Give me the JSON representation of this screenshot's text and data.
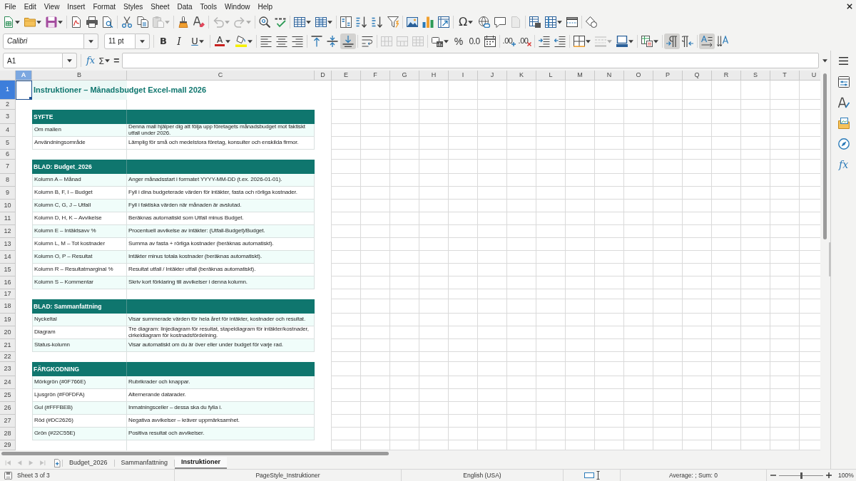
{
  "menu_bar": {
    "items": [
      "File",
      "Edit",
      "View",
      "Insert",
      "Format",
      "Styles",
      "Sheet",
      "Data",
      "Tools",
      "Window",
      "Help"
    ]
  },
  "standard_toolbar": {
    "groups": [
      [
        {
          "kind": "new",
          "dropdown": true,
          "disabled": false
        },
        {
          "kind": "open",
          "dropdown": true,
          "disabled": false
        },
        {
          "kind": "save",
          "dropdown": true,
          "disabled": false
        }
      ],
      [
        {
          "kind": "export_pdf",
          "dropdown": false,
          "disabled": false
        },
        {
          "kind": "print",
          "dropdown": false,
          "disabled": false
        },
        {
          "kind": "print_preview",
          "dropdown": false,
          "disabled": false
        }
      ],
      [
        {
          "kind": "cut",
          "dropdown": false,
          "disabled": false
        },
        {
          "kind": "copy",
          "dropdown": false,
          "disabled": false
        },
        {
          "kind": "paste",
          "dropdown": true,
          "disabled": true
        }
      ],
      [
        {
          "kind": "clone_formatting",
          "dropdown": false,
          "disabled": false
        },
        {
          "kind": "clear_formatting",
          "dropdown": false,
          "disabled": false
        }
      ],
      [
        {
          "kind": "undo",
          "dropdown": true,
          "disabled": true
        },
        {
          "kind": "redo",
          "dropdown": true,
          "disabled": true
        }
      ],
      [
        {
          "kind": "find_replace",
          "dropdown": false,
          "disabled": false
        },
        {
          "kind": "spelling",
          "dropdown": false,
          "disabled": false
        }
      ],
      [
        {
          "kind": "insert_rows",
          "dropdown": true,
          "disabled": false
        },
        {
          "kind": "insert_columns",
          "dropdown": true,
          "disabled": false
        }
      ],
      [
        {
          "kind": "sort",
          "dropdown": false,
          "disabled": false
        },
        {
          "kind": "sort_ascending",
          "dropdown": false,
          "disabled": false
        },
        {
          "kind": "sort_descending",
          "dropdown": false,
          "disabled": false
        },
        {
          "kind": "autofilter",
          "dropdown": false,
          "disabled": false
        }
      ],
      [
        {
          "kind": "image",
          "dropdown": false,
          "disabled": false
        },
        {
          "kind": "chart",
          "dropdown": false,
          "disabled": false
        },
        {
          "kind": "pivot_table",
          "dropdown": false,
          "disabled": false
        }
      ],
      [
        {
          "kind": "special_character",
          "label": "Ω",
          "dropdown": true,
          "disabled": false
        },
        {
          "kind": "hyperlink",
          "dropdown": false,
          "disabled": false
        },
        {
          "kind": "comment",
          "dropdown": false,
          "disabled": false
        },
        {
          "kind": "header_footer",
          "dropdown": false,
          "disabled": true
        }
      ],
      [
        {
          "kind": "print_area",
          "dropdown": false,
          "disabled": false
        },
        {
          "kind": "freeze",
          "dropdown": true,
          "disabled": false
        },
        {
          "kind": "split_window",
          "dropdown": false,
          "disabled": false
        }
      ],
      [
        {
          "kind": "draw_functions",
          "dropdown": false,
          "disabled": false
        }
      ]
    ]
  },
  "formatting_toolbar": {
    "font_name": "Calibri",
    "font_size": "11 pt",
    "groups": [
      [
        {
          "kind": "bold",
          "label": "B",
          "dropdown": false,
          "disabled": false,
          "on": false
        },
        {
          "kind": "italic",
          "label": "I",
          "dropdown": false,
          "disabled": false,
          "on": false
        },
        {
          "kind": "underline",
          "label": "U",
          "dropdown": true,
          "disabled": false,
          "on": false
        }
      ],
      [
        {
          "kind": "font_color",
          "label": "A",
          "dropdown": true,
          "disabled": false,
          "on": false
        },
        {
          "kind": "highlight",
          "dropdown": true,
          "disabled": false,
          "on": false
        }
      ],
      [
        {
          "kind": "align_left",
          "dropdown": false,
          "disabled": false,
          "on": false
        },
        {
          "kind": "align_center",
          "dropdown": false,
          "disabled": false,
          "on": false
        },
        {
          "kind": "align_right",
          "dropdown": false,
          "disabled": false,
          "on": false
        }
      ],
      [
        {
          "kind": "align_top",
          "dropdown": false,
          "disabled": false,
          "on": false
        },
        {
          "kind": "align_middle",
          "dropdown": false,
          "disabled": false,
          "on": false
        },
        {
          "kind": "align_bottom",
          "dropdown": false,
          "disabled": false,
          "on": true
        }
      ],
      [
        {
          "kind": "wrap_text",
          "dropdown": false,
          "disabled": false,
          "on": false
        }
      ],
      [
        {
          "kind": "merge_center",
          "dropdown": false,
          "disabled": true,
          "on": false
        },
        {
          "kind": "merge_cells",
          "dropdown": false,
          "disabled": true,
          "on": false
        },
        {
          "kind": "unmerge_cells",
          "dropdown": false,
          "disabled": true,
          "on": false
        }
      ],
      [
        {
          "kind": "currency",
          "dropdown": true,
          "disabled": false,
          "on": false
        },
        {
          "kind": "percent",
          "label": "%",
          "dropdown": false,
          "disabled": false,
          "on": false
        },
        {
          "kind": "number",
          "label": "0.0",
          "dropdown": false,
          "disabled": false,
          "on": false
        },
        {
          "kind": "date",
          "dropdown": false,
          "disabled": false,
          "on": false
        }
      ],
      [
        {
          "kind": "add_decimal",
          "label": ".00",
          "dropdown": false,
          "disabled": false,
          "on": false
        },
        {
          "kind": "delete_decimal",
          "label": ".00",
          "dropdown": false,
          "disabled": false,
          "on": false
        }
      ],
      [
        {
          "kind": "indent_increase",
          "dropdown": false,
          "disabled": false,
          "on": false
        },
        {
          "kind": "indent_decrease",
          "dropdown": false,
          "disabled": false,
          "on": false
        }
      ],
      [
        {
          "kind": "borders",
          "dropdown": true,
          "disabled": false,
          "on": false
        },
        {
          "kind": "border_style",
          "dropdown": true,
          "disabled": true,
          "on": false
        },
        {
          "kind": "border_color",
          "dropdown": true,
          "disabled": false,
          "on": false
        }
      ],
      [
        {
          "kind": "conditional",
          "dropdown": true,
          "disabled": false,
          "on": false
        }
      ],
      [
        {
          "kind": "para_ltr",
          "dropdown": false,
          "disabled": false,
          "on": true
        },
        {
          "kind": "para_rtl",
          "dropdown": false,
          "disabled": false,
          "on": false
        }
      ],
      [
        {
          "kind": "text_ltr",
          "dropdown": false,
          "disabled": false,
          "on": true
        },
        {
          "kind": "text_ttb",
          "dropdown": false,
          "disabled": false,
          "on": false
        }
      ]
    ]
  },
  "formula_bar": {
    "name_box": "A1",
    "function_wizard": "fx",
    "sum": "Σ",
    "equals": "="
  },
  "sidebar": {
    "decks": [
      {
        "kind": "properties",
        "selected": false
      },
      {
        "kind": "styles",
        "selected": false
      },
      {
        "kind": "gallery",
        "selected": false
      },
      {
        "kind": "navigator",
        "selected": false
      },
      {
        "kind": "functions",
        "label": "fx",
        "selected": false
      }
    ]
  },
  "sheet": {
    "columns": [
      {
        "label": "A",
        "selected": true
      },
      {
        "label": "B",
        "selected": false
      },
      {
        "label": "C",
        "selected": false
      },
      {
        "label": "D",
        "selected": false
      },
      {
        "label": "E",
        "selected": false
      },
      {
        "label": "F",
        "selected": false
      },
      {
        "label": "G",
        "selected": false
      },
      {
        "label": "H",
        "selected": false
      },
      {
        "label": "I",
        "selected": false
      },
      {
        "label": "J",
        "selected": false
      },
      {
        "label": "K",
        "selected": false
      },
      {
        "label": "L",
        "selected": false
      },
      {
        "label": "M",
        "selected": false
      },
      {
        "label": "N",
        "selected": false
      },
      {
        "label": "O",
        "selected": false
      },
      {
        "label": "P",
        "selected": false
      },
      {
        "label": "Q",
        "selected": false
      },
      {
        "label": "R",
        "selected": false
      },
      {
        "label": "S",
        "selected": false
      },
      {
        "label": "T",
        "selected": false
      },
      {
        "label": "U",
        "selected": false
      }
    ],
    "rows": [
      {
        "number": "1",
        "selected": true,
        "kind": "title",
        "cells": [
          "Instruktioner – Månadsbudget Excel-mall 2026"
        ]
      },
      {
        "number": "2",
        "selected": false,
        "kind": "blank"
      },
      {
        "number": "3",
        "selected": false,
        "kind": "header",
        "cells": [
          "SYFTE"
        ]
      },
      {
        "number": "4",
        "selected": false,
        "kind": "data",
        "cells": [
          "Om mallen",
          "Denna mall hjälper dig att följa upp företagets månadsbudget mot faktiskt utfall under 2026."
        ]
      },
      {
        "number": "5",
        "selected": false,
        "kind": "data",
        "cells": [
          "Användningsområde",
          "Lämplig för små och medelstora företag, konsulter och enskilda firmor."
        ]
      },
      {
        "number": "6",
        "selected": false,
        "kind": "blank"
      },
      {
        "number": "7",
        "selected": false,
        "kind": "header",
        "cells": [
          "BLAD: Budget_2026"
        ]
      },
      {
        "number": "8",
        "selected": false,
        "kind": "data",
        "cells": [
          "Kolumn A – Månad",
          "Anger månadsstart i formatet YYYY-MM-DD (t.ex. 2026-01-01)."
        ]
      },
      {
        "number": "9",
        "selected": false,
        "kind": "data",
        "cells": [
          "Kolumn B, F, I – Budget",
          "Fyll i dina budgeterade värden för intäkter, fasta och rörliga kostnader."
        ]
      },
      {
        "number": "10",
        "selected": false,
        "kind": "data",
        "cells": [
          "Kolumn C, G, J – Utfall",
          "Fyll i faktiska värden när månaden är avslutad."
        ]
      },
      {
        "number": "11",
        "selected": false,
        "kind": "data",
        "cells": [
          "Kolumn D, H, K – Avvikelse",
          "Beräknas automatiskt som Utfall minus Budget."
        ]
      },
      {
        "number": "12",
        "selected": false,
        "kind": "data",
        "cells": [
          "Kolumn E – Intäktsavv %",
          "Procentuell avvikelse av intäkter: (Utfall-Budget)/Budget."
        ]
      },
      {
        "number": "13",
        "selected": false,
        "kind": "data",
        "cells": [
          "Kolumn L, M – Tot kostnader",
          "Summa av fasta + rörliga kostnader (beräknas automatiskt)."
        ]
      },
      {
        "number": "14",
        "selected": false,
        "kind": "data",
        "cells": [
          "Kolumn O, P – Resultat",
          "Intäkter minus totala kostnader (beräknas automatiskt)."
        ]
      },
      {
        "number": "15",
        "selected": false,
        "kind": "data",
        "cells": [
          "Kolumn R – Resultatmarginal %",
          "Resultat utfall / Intäkter utfall (beräknas automatiskt)."
        ]
      },
      {
        "number": "16",
        "selected": false,
        "kind": "data",
        "cells": [
          "Kolumn S – Kommentar",
          "Skriv kort förklaring till avvikelser i denna kolumn."
        ]
      },
      {
        "number": "17",
        "selected": false,
        "kind": "blank"
      },
      {
        "number": "18",
        "selected": false,
        "kind": "header",
        "cells": [
          "BLAD: Sammanfattning"
        ]
      },
      {
        "number": "19",
        "selected": false,
        "kind": "data",
        "cells": [
          "Nyckeltal",
          "Visar summerade värden för hela året för intäkter, kostnader och resultat."
        ]
      },
      {
        "number": "20",
        "selected": false,
        "kind": "data",
        "cells": [
          "Diagram",
          "Tre diagram: linjediagram för resultat, stapeldiagram för intäkter/kostnader, cirkeldiagram för kostnadsfördelning."
        ]
      },
      {
        "number": "21",
        "selected": false,
        "kind": "data",
        "cells": [
          "Status-kolumn",
          "Visar automatiskt om du är över eller under budget för varje rad."
        ]
      },
      {
        "number": "22",
        "selected": false,
        "kind": "blank"
      },
      {
        "number": "23",
        "selected": false,
        "kind": "header",
        "cells": [
          "FÄRGKODNING"
        ]
      },
      {
        "number": "24",
        "selected": false,
        "kind": "data",
        "cells": [
          "Mörkgrön (#0F766E)",
          "Rubrikrader och knappar."
        ]
      },
      {
        "number": "25",
        "selected": false,
        "kind": "data",
        "cells": [
          "Ljusgrön (#F0FDFA)",
          "Alternerande datarader."
        ]
      },
      {
        "number": "26",
        "selected": false,
        "kind": "data",
        "cells": [
          "Gul (#FFFBEB)",
          "Inmatningsceller – dessa ska du fylla i."
        ]
      },
      {
        "number": "27",
        "selected": false,
        "kind": "data",
        "cells": [
          "Röd (#DC2626)",
          "Negativa avvikelser – kräver uppmärksamhet."
        ]
      },
      {
        "number": "28",
        "selected": false,
        "kind": "data",
        "cells": [
          "Grön (#22C55E)",
          "Positiva resultat och avvikelser."
        ]
      },
      {
        "number": "29",
        "selected": false,
        "kind": "blank"
      }
    ]
  },
  "sheet_navigation": [
    {
      "kind": "first",
      "disabled": true
    },
    {
      "kind": "previous",
      "disabled": true
    },
    {
      "kind": "next",
      "disabled": true
    },
    {
      "kind": "last",
      "disabled": true
    }
  ],
  "sheet_tabs": [
    {
      "label": "Budget_2026",
      "selected": false
    },
    {
      "label": "Sammanfattning",
      "selected": false
    },
    {
      "label": "Instruktioner",
      "selected": true
    }
  ],
  "status_bar": {
    "sheet_position": "Sheet 3 of 3",
    "page_style": "PageStyle_Instruktioner",
    "language": "English (USA)",
    "selection_summary": "Average: ; Sum: 0",
    "zoom": {
      "level": 0.5,
      "reading": "100%"
    }
  }
}
